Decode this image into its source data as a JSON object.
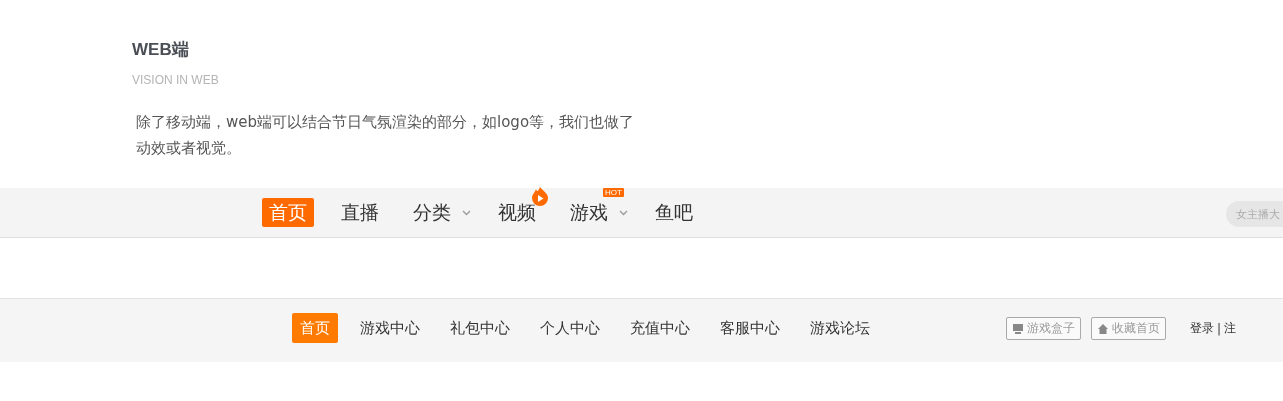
{
  "section": {
    "title": "WEB端",
    "subtitle": "VISION IN WEB",
    "description": "除了移动端，web端可以结合节日气氛渲染的部分，如logo等，我们也做了动效或者视觉。"
  },
  "main_nav": {
    "items": [
      {
        "label": "首页",
        "selected": true
      },
      {
        "label": "直播",
        "selected": false
      },
      {
        "label": "分类",
        "selected": false,
        "dropdown": true
      },
      {
        "label": "视频",
        "selected": false,
        "kind": "flame"
      },
      {
        "label": "游戏",
        "selected": false,
        "dropdown": true,
        "kind": "tag",
        "badge": "HOT"
      },
      {
        "label": "鱼吧",
        "selected": false
      }
    ],
    "search": {
      "placeholder": "女主播大"
    }
  },
  "game_nav": {
    "items": [
      {
        "label": "首页",
        "selected": true
      },
      {
        "label": "游戏中心",
        "selected": false
      },
      {
        "label": "礼包中心",
        "selected": false
      },
      {
        "label": "个人中心",
        "selected": false
      },
      {
        "label": "充值中心",
        "selected": false
      },
      {
        "label": "客服中心",
        "selected": false
      },
      {
        "label": "游戏论坛",
        "selected": false
      }
    ],
    "buttons": [
      {
        "label": "游戏盒子",
        "kind": "monitor"
      },
      {
        "label": "收藏首页",
        "kind": "house"
      }
    ],
    "login": "登录",
    "separator": "|",
    "register": "注"
  }
}
